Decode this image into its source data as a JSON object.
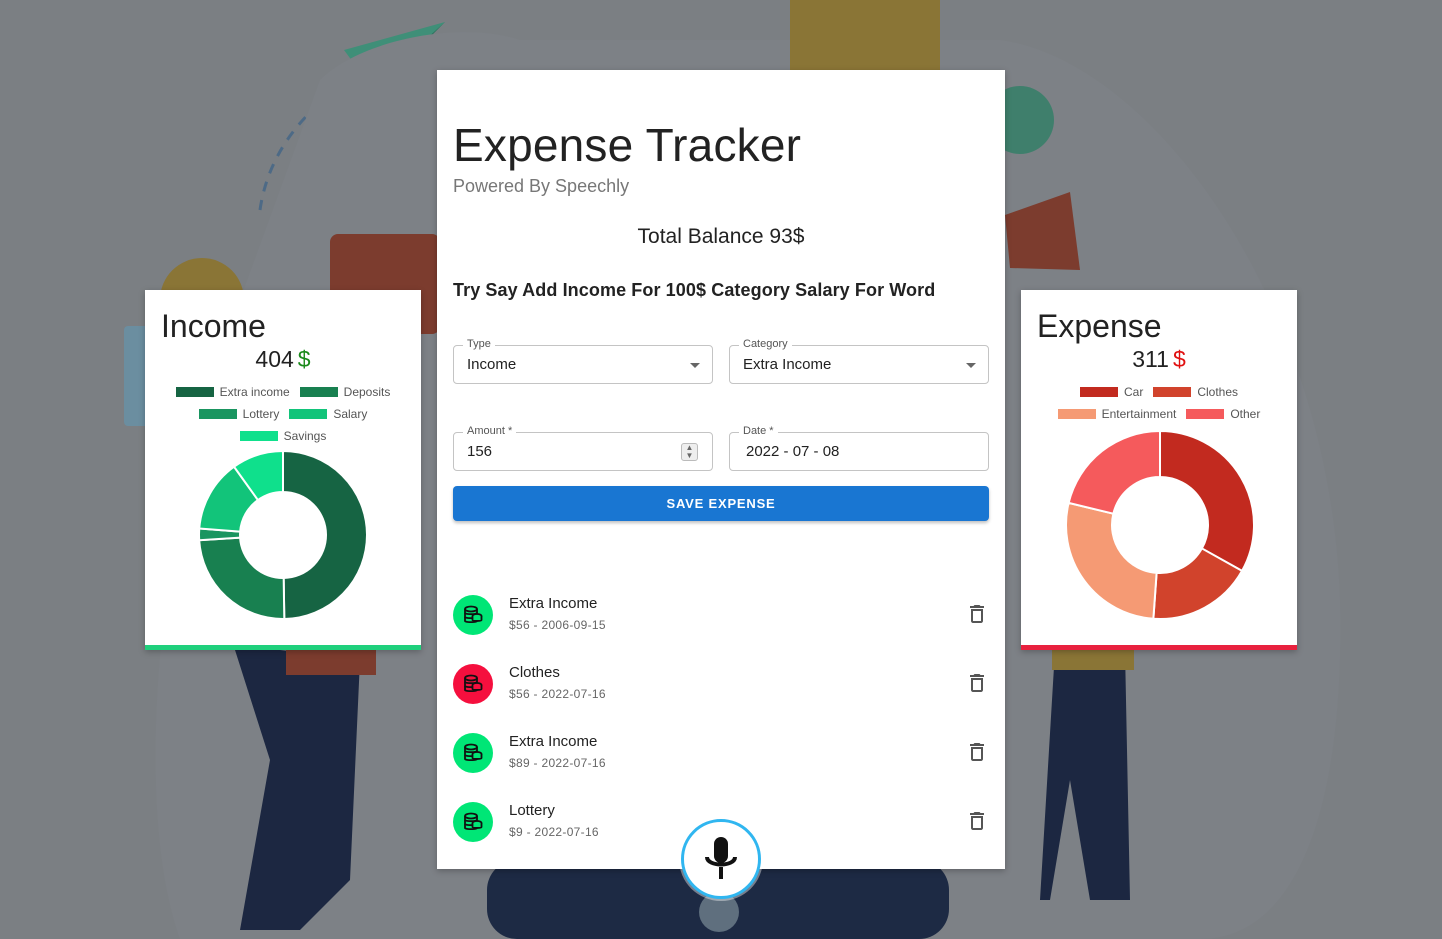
{
  "app": {
    "title": "Expense Tracker",
    "subtitle": "Powered By Speechly",
    "balance": "Total Balance 93$",
    "hint": "Try Say Add Income For 100$ Category Salary For Word"
  },
  "form": {
    "type_label": "Type",
    "type_value": "Income",
    "category_label": "Category",
    "category_value": "Extra Income",
    "amount_label": "Amount *",
    "amount_value": "156",
    "date_label": "Date *",
    "date_value": "2022 - 07 - 08",
    "save_label": "SAVE EXPENSE"
  },
  "transactions": [
    {
      "name": "Extra Income",
      "detail": "$56 - 2006-09-15",
      "kind": "income",
      "icon": "coins-icon",
      "delete_icon": "trash-icon"
    },
    {
      "name": "Clothes",
      "detail": "$56 - 2022-07-16",
      "kind": "expense",
      "icon": "coins-icon",
      "delete_icon": "trash-icon"
    },
    {
      "name": "Extra Income",
      "detail": "$89 - 2022-07-16",
      "kind": "income",
      "icon": "coins-icon",
      "delete_icon": "trash-icon"
    },
    {
      "name": "Lottery",
      "detail": "$9 - 2022-07-16",
      "kind": "income",
      "icon": "coins-icon",
      "delete_icon": "trash-icon"
    }
  ],
  "income": {
    "title": "Income",
    "total": "404",
    "currency": "$",
    "currency_color": "#1a8a1a",
    "accent": "#1fd07c"
  },
  "expense": {
    "title": "Expense",
    "total": "311",
    "currency": "$",
    "currency_color": "#e01010",
    "accent": "#e8213e"
  },
  "colors": {
    "income_avatar": "#00e676",
    "expense_avatar": "#f50f3e",
    "save_button": "#1976d2",
    "mic_ring": "#30b6f0"
  },
  "mic_icon": "microphone-icon",
  "chart_data": [
    {
      "type": "pie",
      "donut": true,
      "legend": [
        "Extra income",
        "Deposits",
        "Lottery",
        "Salary",
        "Savings"
      ],
      "labels": [
        "Extra income",
        "Deposits",
        "Lottery",
        "Salary",
        "Savings"
      ],
      "values": [
        201,
        98,
        9,
        56,
        40
      ],
      "colors": [
        "#166443",
        "#188050",
        "#1a9560",
        "#12c47a",
        "#0fe08c"
      ],
      "legend_position": "top"
    },
    {
      "type": "pie",
      "donut": true,
      "legend": [
        "Car",
        "Clothes",
        "Entertainment",
        "Other"
      ],
      "labels": [
        "Car",
        "Clothes",
        "Entertainment",
        "Other"
      ],
      "values": [
        103,
        56,
        86,
        66
      ],
      "colors": [
        "#c22a1f",
        "#d1432c",
        "#f59a74",
        "#f55a5c"
      ],
      "legend_position": "top"
    }
  ]
}
